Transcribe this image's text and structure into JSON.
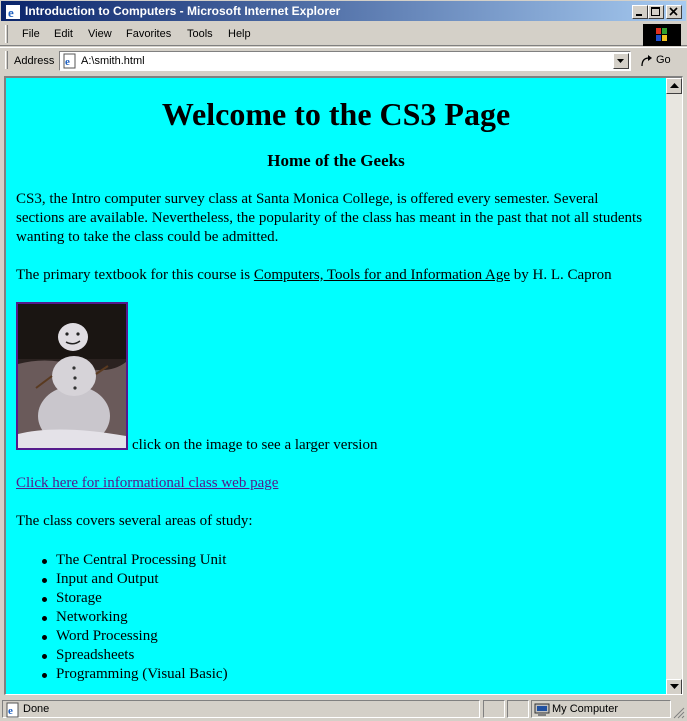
{
  "window": {
    "title": "Introduction to Computers - Microsoft Internet Explorer"
  },
  "menu": [
    "File",
    "Edit",
    "View",
    "Favorites",
    "Tools",
    "Help"
  ],
  "address": {
    "label": "Address",
    "url": "A:\\smith.html",
    "go_label": "Go"
  },
  "page": {
    "heading": "Welcome to the CS3 Page",
    "subheading": "Home of the Geeks",
    "intro": "CS3, the Intro computer survey class at Santa Monica College, is offered every semester. Several sections are available. Nevertheless, the popularity of the class has meant in the past that not all students wanting to take the class could be admitted.",
    "textbook_prefix": "The primary textbook for this course is ",
    "textbook_title": "Computers, Tools for and Information Age",
    "textbook_suffix": " by H. L. Capron",
    "image_caption": "click on the image to see a larger version",
    "class_link": "Click here for informational class web page",
    "areas_intro": "The class covers several areas of study:",
    "topics": [
      "The Central Processing Unit",
      "Input and Output",
      "Storage",
      "Networking",
      "Word Processing",
      "Spreadsheets",
      "Programming (Visual Basic)"
    ]
  },
  "status": {
    "left": "Done",
    "zone": "My Computer"
  },
  "colors": {
    "page_background": "#00ffff",
    "title_bar": "#0a246a",
    "visited_link": "#551a8b"
  }
}
